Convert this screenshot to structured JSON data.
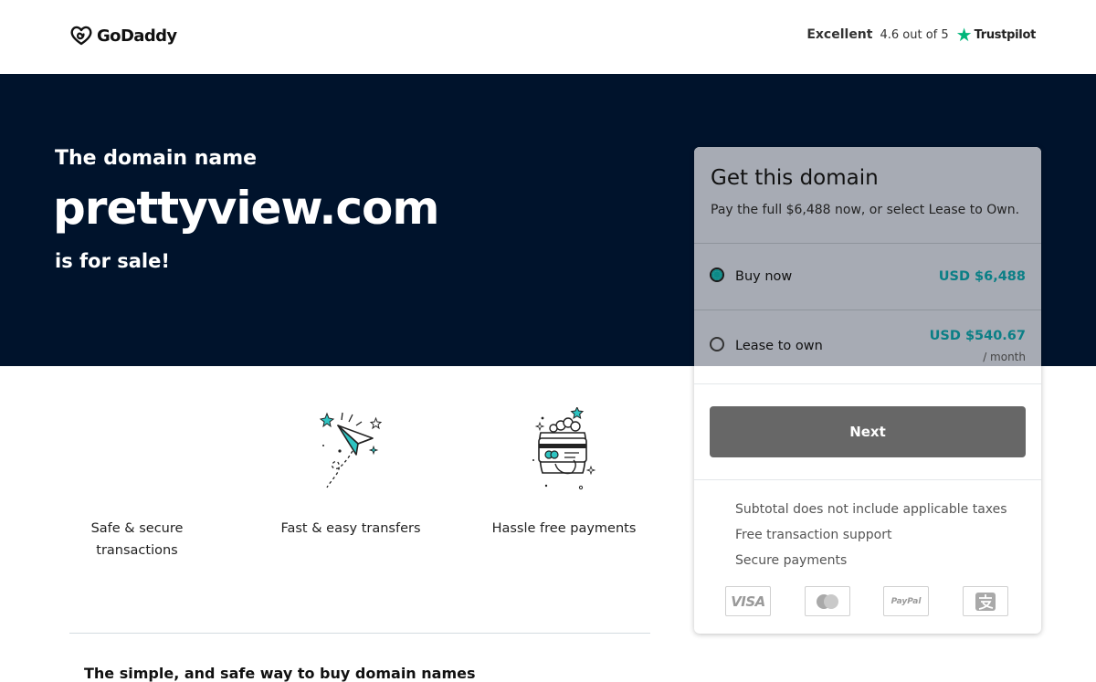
{
  "header": {
    "logo_text": "GoDaddy",
    "rating_word": "Excellent",
    "rating_score": "4.6 out of 5",
    "rating_brand": "Trustpilot"
  },
  "hero": {
    "lead": "The domain name",
    "domain": "prettyview.com",
    "suffix": "is for sale!"
  },
  "features": [
    {
      "label_line1": "Safe & secure",
      "label_line2": "transactions"
    },
    {
      "label": "Fast & easy transfers",
      "icon": "paper-plane-icon"
    },
    {
      "label": "Hassle free payments",
      "icon": "payment-card-icon"
    }
  ],
  "card": {
    "title": "Get this domain",
    "subtitle": "Pay the full $6,488 now, or select Lease to Own.",
    "options": [
      {
        "label": "Buy now",
        "price": "USD $6,488",
        "selected": true
      },
      {
        "label": "Lease to own",
        "price": "USD $540.67",
        "unit": "/ month",
        "selected": false
      }
    ],
    "next_label": "Next",
    "notes": [
      "Subtotal does not include applicable taxes",
      "Free transaction support",
      "Secure payments"
    ],
    "payment_methods": [
      "visa-icon",
      "mastercard-icon",
      "paypal-icon",
      "alipay-icon"
    ],
    "visa_text": "VISA",
    "paypal_text": "PayPal"
  },
  "footer": {
    "tagline": "The simple, and safe way to buy domain names"
  },
  "colors": {
    "hero_bg": "#00132c",
    "accent_teal": "#0b7f86",
    "button_bg": "#676767",
    "trustpilot_green": "#00b67a"
  }
}
